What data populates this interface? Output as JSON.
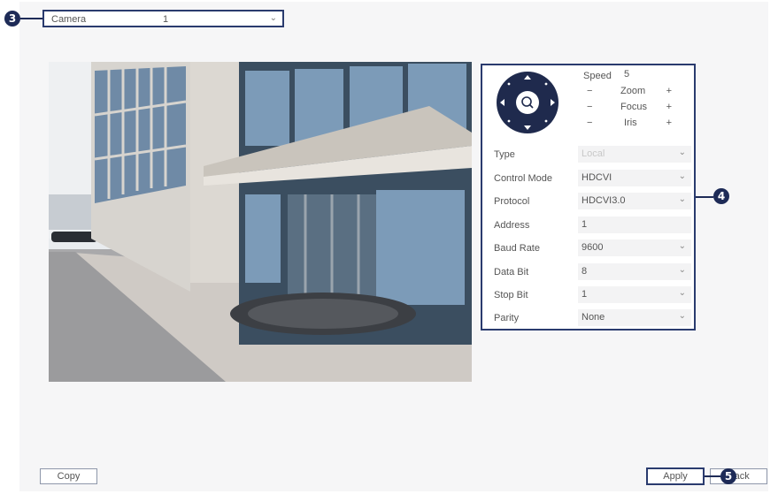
{
  "camera_selector": {
    "label": "Camera",
    "value": "1"
  },
  "callouts": {
    "camera": "3",
    "controls": "4",
    "apply": "5"
  },
  "ptz": {
    "speed_label": "Speed",
    "speed_value": "5",
    "zoom": {
      "minus": "−",
      "name": "Zoom",
      "plus": "+"
    },
    "focus": {
      "minus": "−",
      "name": "Focus",
      "plus": "+"
    },
    "iris": {
      "minus": "−",
      "name": "Iris",
      "plus": "+"
    }
  },
  "fields": {
    "type": {
      "label": "Type",
      "value": "Local"
    },
    "control_mode": {
      "label": "Control Mode",
      "value": "HDCVI"
    },
    "protocol": {
      "label": "Protocol",
      "value": "HDCVI3.0"
    },
    "address": {
      "label": "Address",
      "value": "1"
    },
    "baud_rate": {
      "label": "Baud Rate",
      "value": "9600"
    },
    "data_bit": {
      "label": "Data Bit",
      "value": "8"
    },
    "stop_bit": {
      "label": "Stop Bit",
      "value": "1"
    },
    "parity": {
      "label": "Parity",
      "value": "None"
    }
  },
  "buttons": {
    "copy": "Copy",
    "apply": "Apply",
    "back": "Back"
  },
  "colors": {
    "callout": "#1e2b57",
    "accent_border": "#2a3b6e"
  }
}
